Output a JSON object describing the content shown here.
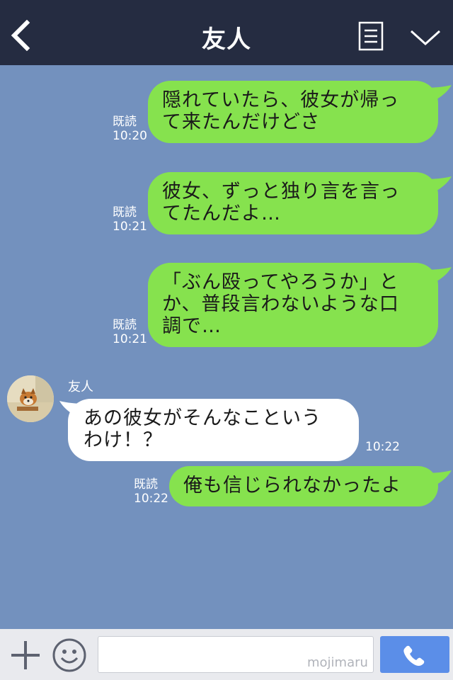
{
  "header": {
    "title": "友人"
  },
  "messages": [
    {
      "sender": "me",
      "lines": [
        "隠れていたら、彼女が帰っ",
        "て来たんだけどさ"
      ],
      "read": "既読",
      "time": "10:20"
    },
    {
      "sender": "me",
      "lines": [
        "彼女、ずっと独り言を言っ",
        "てたんだよ…"
      ],
      "read": "既読",
      "time": "10:21"
    },
    {
      "sender": "me",
      "lines": [
        "「ぶん殴ってやろうか」と",
        "か、普段言わないような口",
        "調で…"
      ],
      "read": "既読",
      "time": "10:21"
    },
    {
      "sender": "friend",
      "name": "友人",
      "lines": [
        "あの彼女がそんなこという",
        "わけ！？"
      ],
      "time": "10:22"
    },
    {
      "sender": "me",
      "lines": [
        "俺も信じられなかったよ"
      ],
      "read": "既読",
      "time": "10:22"
    }
  ],
  "input": {
    "value": "",
    "watermark": "mojimaru"
  },
  "icons": {
    "back": "chevron-left-icon",
    "menu": "notes-icon",
    "collapse": "chevron-down-icon",
    "add": "plus-icon",
    "emoji": "smiley-icon",
    "call": "phone-icon"
  },
  "colors": {
    "header": "#252c41",
    "background": "#7391be",
    "my_bubble": "#86e24e",
    "friend_bubble": "#ffffff",
    "call_button": "#5b8ee8",
    "footer": "#e9eaee"
  }
}
